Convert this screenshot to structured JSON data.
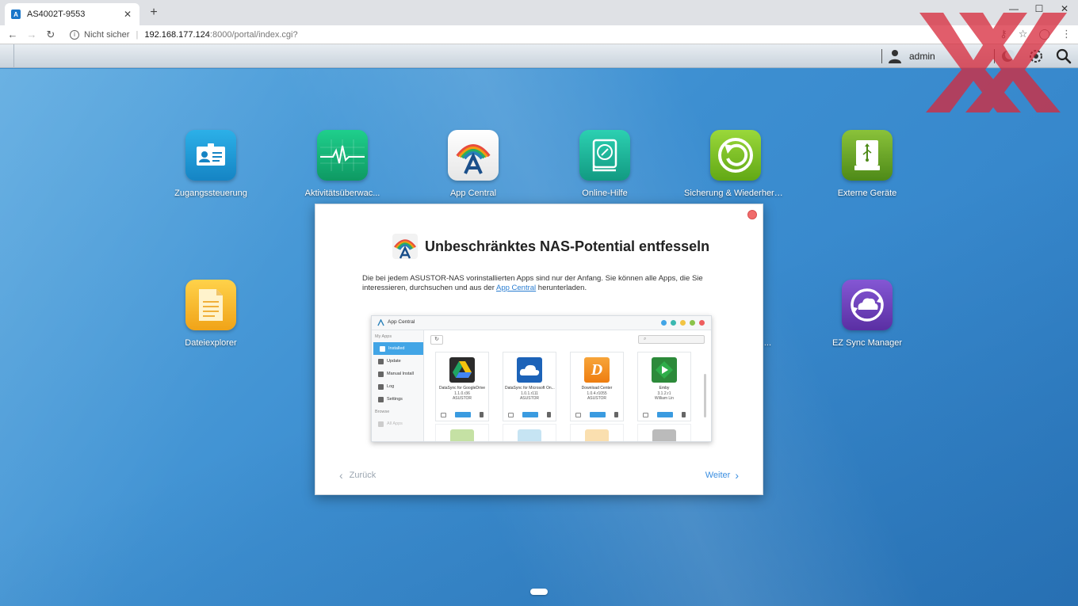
{
  "browser": {
    "tab_title": "AS4002T-9553",
    "new_tab": "+",
    "url_host": "192.168.177.124",
    "url_path": ":8000/portal/index.cgi?",
    "security": "Nicht sicher"
  },
  "nas_bar": {
    "username": "admin"
  },
  "desktop": {
    "apps": [
      {
        "label": "Zugangssteuerung",
        "icon": "id-card-icon",
        "color": "#1a9ad6"
      },
      {
        "label": "Aktivitätsüberwac...",
        "icon": "heartbeat-monitor-icon",
        "color": "#14b27a"
      },
      {
        "label": "App Central",
        "icon": "app-central-icon",
        "color": "#f5f5f5"
      },
      {
        "label": "Online-Hilfe",
        "icon": "help-book-icon",
        "color": "#1ab59a"
      },
      {
        "label": "Sicherung & Wiederherstellung",
        "icon": "backup-restore-icon",
        "color": "#7cc41f"
      },
      {
        "label": "Externe Geräte",
        "icon": "external-drive-icon",
        "color": "#6ea92a"
      },
      {
        "label": "Dateiexplorer",
        "icon": "folder-icon",
        "color": "#f5b323"
      },
      {
        "label": "...",
        "icon": "",
        "color": ""
      },
      {
        "label": "EZ Sync Manager",
        "icon": "ez-sync-icon",
        "color": "#6b3fb8"
      }
    ]
  },
  "dialog": {
    "title": "Unbeschränktes NAS-Potential entfesseln",
    "text_before": "Die bei jedem ASUSTOR-NAS vorinstallierten Apps sind nur der Anfang. Sie können alle Apps, die Sie interessieren, durchsuchen und aus der ",
    "link_text": "App Central",
    "text_after": " herunterladen.",
    "back_label": "Zurück",
    "next_label": "Weiter",
    "preview": {
      "window_title": "App Central",
      "section_my_apps": "My Apps",
      "section_browse": "Browse",
      "nav": [
        "Installed",
        "Update",
        "Manual Install",
        "Log",
        "Settings"
      ],
      "nav_faded": "All Apps",
      "cards": [
        {
          "name": "DataSync for GoogleDrive",
          "version": "1.1.0.r36",
          "author": "ASUSTOR",
          "color": "#2b2b2b"
        },
        {
          "name": "DataSync for Microsoft On...",
          "version": "1.0.1.r111",
          "author": "ASUSTOR",
          "color": "#1d63b8"
        },
        {
          "name": "Download Center",
          "version": "1.0.4.r1055",
          "author": "ASUSTOR",
          "color": "#f08a1c"
        },
        {
          "name": "Emby",
          "version": "3.1.2.r1",
          "author": "William Lin",
          "color": "#2c8a3a"
        }
      ]
    }
  },
  "colors": {
    "accent": "#3b8ee0",
    "dialog_close": "#f06b6b",
    "dot_blue": "#42a5e6",
    "dot_teal": "#3bb8b0",
    "dot_yellow": "#f2c443",
    "dot_green": "#8bc34a",
    "dot_red": "#ee5e5e"
  }
}
